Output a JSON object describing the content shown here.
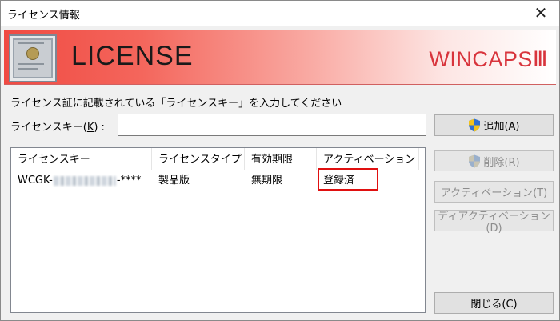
{
  "window": {
    "title": "ライセンス情報",
    "close_glyph": "✕"
  },
  "banner": {
    "license_text": "LICENSE",
    "brand": "WINCAPSⅢ"
  },
  "instruction": "ライセンス証に記載されている「ライセンスキー」を入力してください",
  "key_field": {
    "label_prefix": "ライセンスキー(",
    "label_accel": "K",
    "label_suffix": ") :",
    "value": "",
    "placeholder": ""
  },
  "buttons": {
    "add": "追加(A)",
    "delete": "削除(R)",
    "activate": "アクティベーション(T)",
    "deactivate": "ディアクティベーション(D)",
    "close": "閉じる(C)"
  },
  "table": {
    "columns": [
      "ライセンスキー",
      "ライセンスタイプ",
      "有効期限",
      "アクティベーション"
    ],
    "rows": [
      {
        "key_prefix": "WCGK-",
        "key_suffix": "-****",
        "type": "製品版",
        "expiry": "無期限",
        "activation": "登録済"
      }
    ]
  },
  "colors": {
    "brand_red": "#d8343c",
    "highlight": "#e01010"
  }
}
